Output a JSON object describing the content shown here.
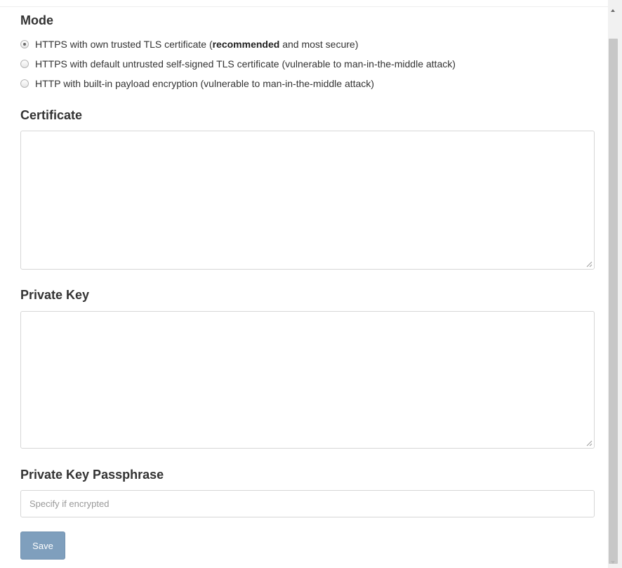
{
  "mode": {
    "title": "Mode",
    "options": [
      {
        "parts": [
          "HTTPS with own trusted TLS certificate (",
          "recommended",
          " and most secure)"
        ],
        "checked": true
      },
      {
        "label": "HTTPS with default untrusted self-signed TLS certificate (vulnerable to man-in-the-middle attack)",
        "checked": false
      },
      {
        "label": "HTTP with built-in payload encryption (vulnerable to man-in-the-middle attack)",
        "checked": false
      }
    ]
  },
  "certificate": {
    "title": "Certificate",
    "value": ""
  },
  "private_key": {
    "title": "Private Key",
    "value": ""
  },
  "passphrase": {
    "title": "Private Key Passphrase",
    "placeholder": "Specify if encrypted",
    "value": ""
  },
  "actions": {
    "save_label": "Save"
  },
  "colors": {
    "button_bg": "#7f9fbd",
    "text": "#333333",
    "border": "#d6d6d6"
  }
}
